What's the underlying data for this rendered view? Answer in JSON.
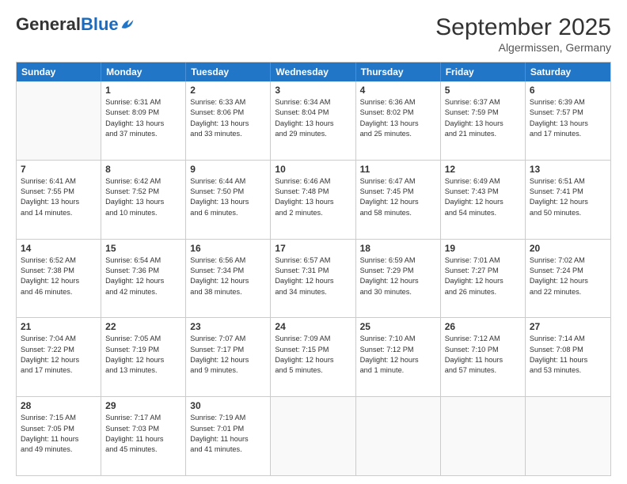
{
  "header": {
    "logo_general": "General",
    "logo_blue": "Blue",
    "month_title": "September 2025",
    "subtitle": "Algermissen, Germany"
  },
  "weekdays": [
    "Sunday",
    "Monday",
    "Tuesday",
    "Wednesday",
    "Thursday",
    "Friday",
    "Saturday"
  ],
  "rows": [
    [
      {
        "day": "",
        "lines": [],
        "empty": true
      },
      {
        "day": "1",
        "lines": [
          "Sunrise: 6:31 AM",
          "Sunset: 8:09 PM",
          "Daylight: 13 hours",
          "and 37 minutes."
        ]
      },
      {
        "day": "2",
        "lines": [
          "Sunrise: 6:33 AM",
          "Sunset: 8:06 PM",
          "Daylight: 13 hours",
          "and 33 minutes."
        ]
      },
      {
        "day": "3",
        "lines": [
          "Sunrise: 6:34 AM",
          "Sunset: 8:04 PM",
          "Daylight: 13 hours",
          "and 29 minutes."
        ]
      },
      {
        "day": "4",
        "lines": [
          "Sunrise: 6:36 AM",
          "Sunset: 8:02 PM",
          "Daylight: 13 hours",
          "and 25 minutes."
        ]
      },
      {
        "day": "5",
        "lines": [
          "Sunrise: 6:37 AM",
          "Sunset: 7:59 PM",
          "Daylight: 13 hours",
          "and 21 minutes."
        ]
      },
      {
        "day": "6",
        "lines": [
          "Sunrise: 6:39 AM",
          "Sunset: 7:57 PM",
          "Daylight: 13 hours",
          "and 17 minutes."
        ]
      }
    ],
    [
      {
        "day": "7",
        "lines": [
          "Sunrise: 6:41 AM",
          "Sunset: 7:55 PM",
          "Daylight: 13 hours",
          "and 14 minutes."
        ]
      },
      {
        "day": "8",
        "lines": [
          "Sunrise: 6:42 AM",
          "Sunset: 7:52 PM",
          "Daylight: 13 hours",
          "and 10 minutes."
        ]
      },
      {
        "day": "9",
        "lines": [
          "Sunrise: 6:44 AM",
          "Sunset: 7:50 PM",
          "Daylight: 13 hours",
          "and 6 minutes."
        ]
      },
      {
        "day": "10",
        "lines": [
          "Sunrise: 6:46 AM",
          "Sunset: 7:48 PM",
          "Daylight: 13 hours",
          "and 2 minutes."
        ]
      },
      {
        "day": "11",
        "lines": [
          "Sunrise: 6:47 AM",
          "Sunset: 7:45 PM",
          "Daylight: 12 hours",
          "and 58 minutes."
        ]
      },
      {
        "day": "12",
        "lines": [
          "Sunrise: 6:49 AM",
          "Sunset: 7:43 PM",
          "Daylight: 12 hours",
          "and 54 minutes."
        ]
      },
      {
        "day": "13",
        "lines": [
          "Sunrise: 6:51 AM",
          "Sunset: 7:41 PM",
          "Daylight: 12 hours",
          "and 50 minutes."
        ]
      }
    ],
    [
      {
        "day": "14",
        "lines": [
          "Sunrise: 6:52 AM",
          "Sunset: 7:38 PM",
          "Daylight: 12 hours",
          "and 46 minutes."
        ]
      },
      {
        "day": "15",
        "lines": [
          "Sunrise: 6:54 AM",
          "Sunset: 7:36 PM",
          "Daylight: 12 hours",
          "and 42 minutes."
        ]
      },
      {
        "day": "16",
        "lines": [
          "Sunrise: 6:56 AM",
          "Sunset: 7:34 PM",
          "Daylight: 12 hours",
          "and 38 minutes."
        ]
      },
      {
        "day": "17",
        "lines": [
          "Sunrise: 6:57 AM",
          "Sunset: 7:31 PM",
          "Daylight: 12 hours",
          "and 34 minutes."
        ]
      },
      {
        "day": "18",
        "lines": [
          "Sunrise: 6:59 AM",
          "Sunset: 7:29 PM",
          "Daylight: 12 hours",
          "and 30 minutes."
        ]
      },
      {
        "day": "19",
        "lines": [
          "Sunrise: 7:01 AM",
          "Sunset: 7:27 PM",
          "Daylight: 12 hours",
          "and 26 minutes."
        ]
      },
      {
        "day": "20",
        "lines": [
          "Sunrise: 7:02 AM",
          "Sunset: 7:24 PM",
          "Daylight: 12 hours",
          "and 22 minutes."
        ]
      }
    ],
    [
      {
        "day": "21",
        "lines": [
          "Sunrise: 7:04 AM",
          "Sunset: 7:22 PM",
          "Daylight: 12 hours",
          "and 17 minutes."
        ]
      },
      {
        "day": "22",
        "lines": [
          "Sunrise: 7:05 AM",
          "Sunset: 7:19 PM",
          "Daylight: 12 hours",
          "and 13 minutes."
        ]
      },
      {
        "day": "23",
        "lines": [
          "Sunrise: 7:07 AM",
          "Sunset: 7:17 PM",
          "Daylight: 12 hours",
          "and 9 minutes."
        ]
      },
      {
        "day": "24",
        "lines": [
          "Sunrise: 7:09 AM",
          "Sunset: 7:15 PM",
          "Daylight: 12 hours",
          "and 5 minutes."
        ]
      },
      {
        "day": "25",
        "lines": [
          "Sunrise: 7:10 AM",
          "Sunset: 7:12 PM",
          "Daylight: 12 hours",
          "and 1 minute."
        ]
      },
      {
        "day": "26",
        "lines": [
          "Sunrise: 7:12 AM",
          "Sunset: 7:10 PM",
          "Daylight: 11 hours",
          "and 57 minutes."
        ]
      },
      {
        "day": "27",
        "lines": [
          "Sunrise: 7:14 AM",
          "Sunset: 7:08 PM",
          "Daylight: 11 hours",
          "and 53 minutes."
        ]
      }
    ],
    [
      {
        "day": "28",
        "lines": [
          "Sunrise: 7:15 AM",
          "Sunset: 7:05 PM",
          "Daylight: 11 hours",
          "and 49 minutes."
        ]
      },
      {
        "day": "29",
        "lines": [
          "Sunrise: 7:17 AM",
          "Sunset: 7:03 PM",
          "Daylight: 11 hours",
          "and 45 minutes."
        ]
      },
      {
        "day": "30",
        "lines": [
          "Sunrise: 7:19 AM",
          "Sunset: 7:01 PM",
          "Daylight: 11 hours",
          "and 41 minutes."
        ]
      },
      {
        "day": "",
        "lines": [],
        "empty": true
      },
      {
        "day": "",
        "lines": [],
        "empty": true
      },
      {
        "day": "",
        "lines": [],
        "empty": true
      },
      {
        "day": "",
        "lines": [],
        "empty": true
      }
    ]
  ]
}
